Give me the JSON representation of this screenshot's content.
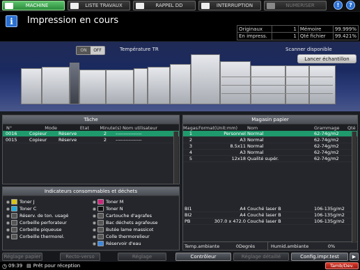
{
  "tabs": {
    "machine": "MACHINE",
    "jobs": "LISTE TRAVAUX",
    "recall": "RAPPEL DD",
    "interrupt": "INTERRUPTION",
    "numeriser": "NUMERISER"
  },
  "header": {
    "title": "Impression en cours",
    "originals_label": "Originaux",
    "originals_value": "1",
    "memory_label": "Mémoire",
    "memory_value": "99.999%",
    "printing_label": "En impress.",
    "printing_value": "1",
    "file_qty_label": "Qté fichier",
    "file_qty_value": "99.421%"
  },
  "machine": {
    "toggle_on": "ON",
    "toggle_off": "OFF",
    "temperature_label": "Température TR",
    "scanner_status": "Scanner disponible",
    "launch_sample_button": "Lancer échantillon"
  },
  "jobs": {
    "title": "Tâche",
    "columns": [
      "N°",
      "Mode",
      "Etat",
      "Minute(s)",
      "Nom utilisateur"
    ],
    "rows": [
      {
        "num": "0016",
        "mode": "Copieur",
        "state": "Réserve",
        "minutes": "2",
        "user": "----------------",
        "selected": true
      },
      {
        "num": "0015",
        "mode": "Copieur",
        "state": "Réserve",
        "minutes": "2",
        "user": "----------------",
        "selected": false
      }
    ]
  },
  "consumables": {
    "title": "Indicateurs consommables et déchets",
    "left": [
      "Toner J",
      "Toner C",
      "Réserv. de ton. usagé",
      "Corbeille perforateur",
      "Corbeille piqueuse",
      "Corbeille thermorel."
    ],
    "right": [
      "Toner M",
      "Toner N",
      "Cartouche d'agrafes",
      "Bac déchets agrafeuse",
      "Butée lame massicot",
      "Colle thermorelieur",
      "Réservoir d'eau"
    ]
  },
  "paper": {
    "title": "Magasin papier",
    "columns": [
      "Magas.",
      "Format(Unit:mm)",
      "Nom",
      "Grammage",
      "Qté"
    ],
    "rows": [
      {
        "tray": "1",
        "format": "Personnel",
        "name": "Normal",
        "weight": "62-74g/m2",
        "selected": true
      },
      {
        "tray": "2",
        "format": "A3",
        "name": "Normal",
        "weight": "62-74g/m2",
        "selected": false
      },
      {
        "tray": "3",
        "format": "8.5x11",
        "name": "Normal",
        "weight": "62-74g/m2",
        "selected": false
      },
      {
        "tray": "4",
        "format": "A3",
        "name": "Normal",
        "weight": "62-74g/m2",
        "selected": false
      },
      {
        "tray": "5",
        "format": "12x18",
        "name": "Qualité supér.",
        "weight": "62-74g/m2",
        "selected": false
      }
    ],
    "extra_rows": [
      {
        "tray": "BI1",
        "format": "A4",
        "name": "Couché laser B",
        "weight": "106-135g/m2"
      },
      {
        "tray": "BI2",
        "format": "A4",
        "name": "Couché laser B",
        "weight": "106-135g/m2"
      },
      {
        "tray": "PB",
        "format": "307.0 x 472.0",
        "name": "Couché laser B",
        "weight": "106-135g/m2"
      }
    ],
    "ambient_temp_label": "Temp.ambiante",
    "ambient_temp_value": "0Degrés",
    "ambient_hum_label": "Humid.ambiante",
    "ambient_hum_value": "0%"
  },
  "bottom": {
    "b1": "Réglage papier",
    "b2": "Recto-verso",
    "b3": "Réglage",
    "b4": "Contrôleur",
    "b5": "Réglage détaillé",
    "b6": "Config.impr.test"
  },
  "status": {
    "time": "09:39",
    "message": "Prêt pour réception",
    "tamb_label": "Tamb/Dev."
  }
}
